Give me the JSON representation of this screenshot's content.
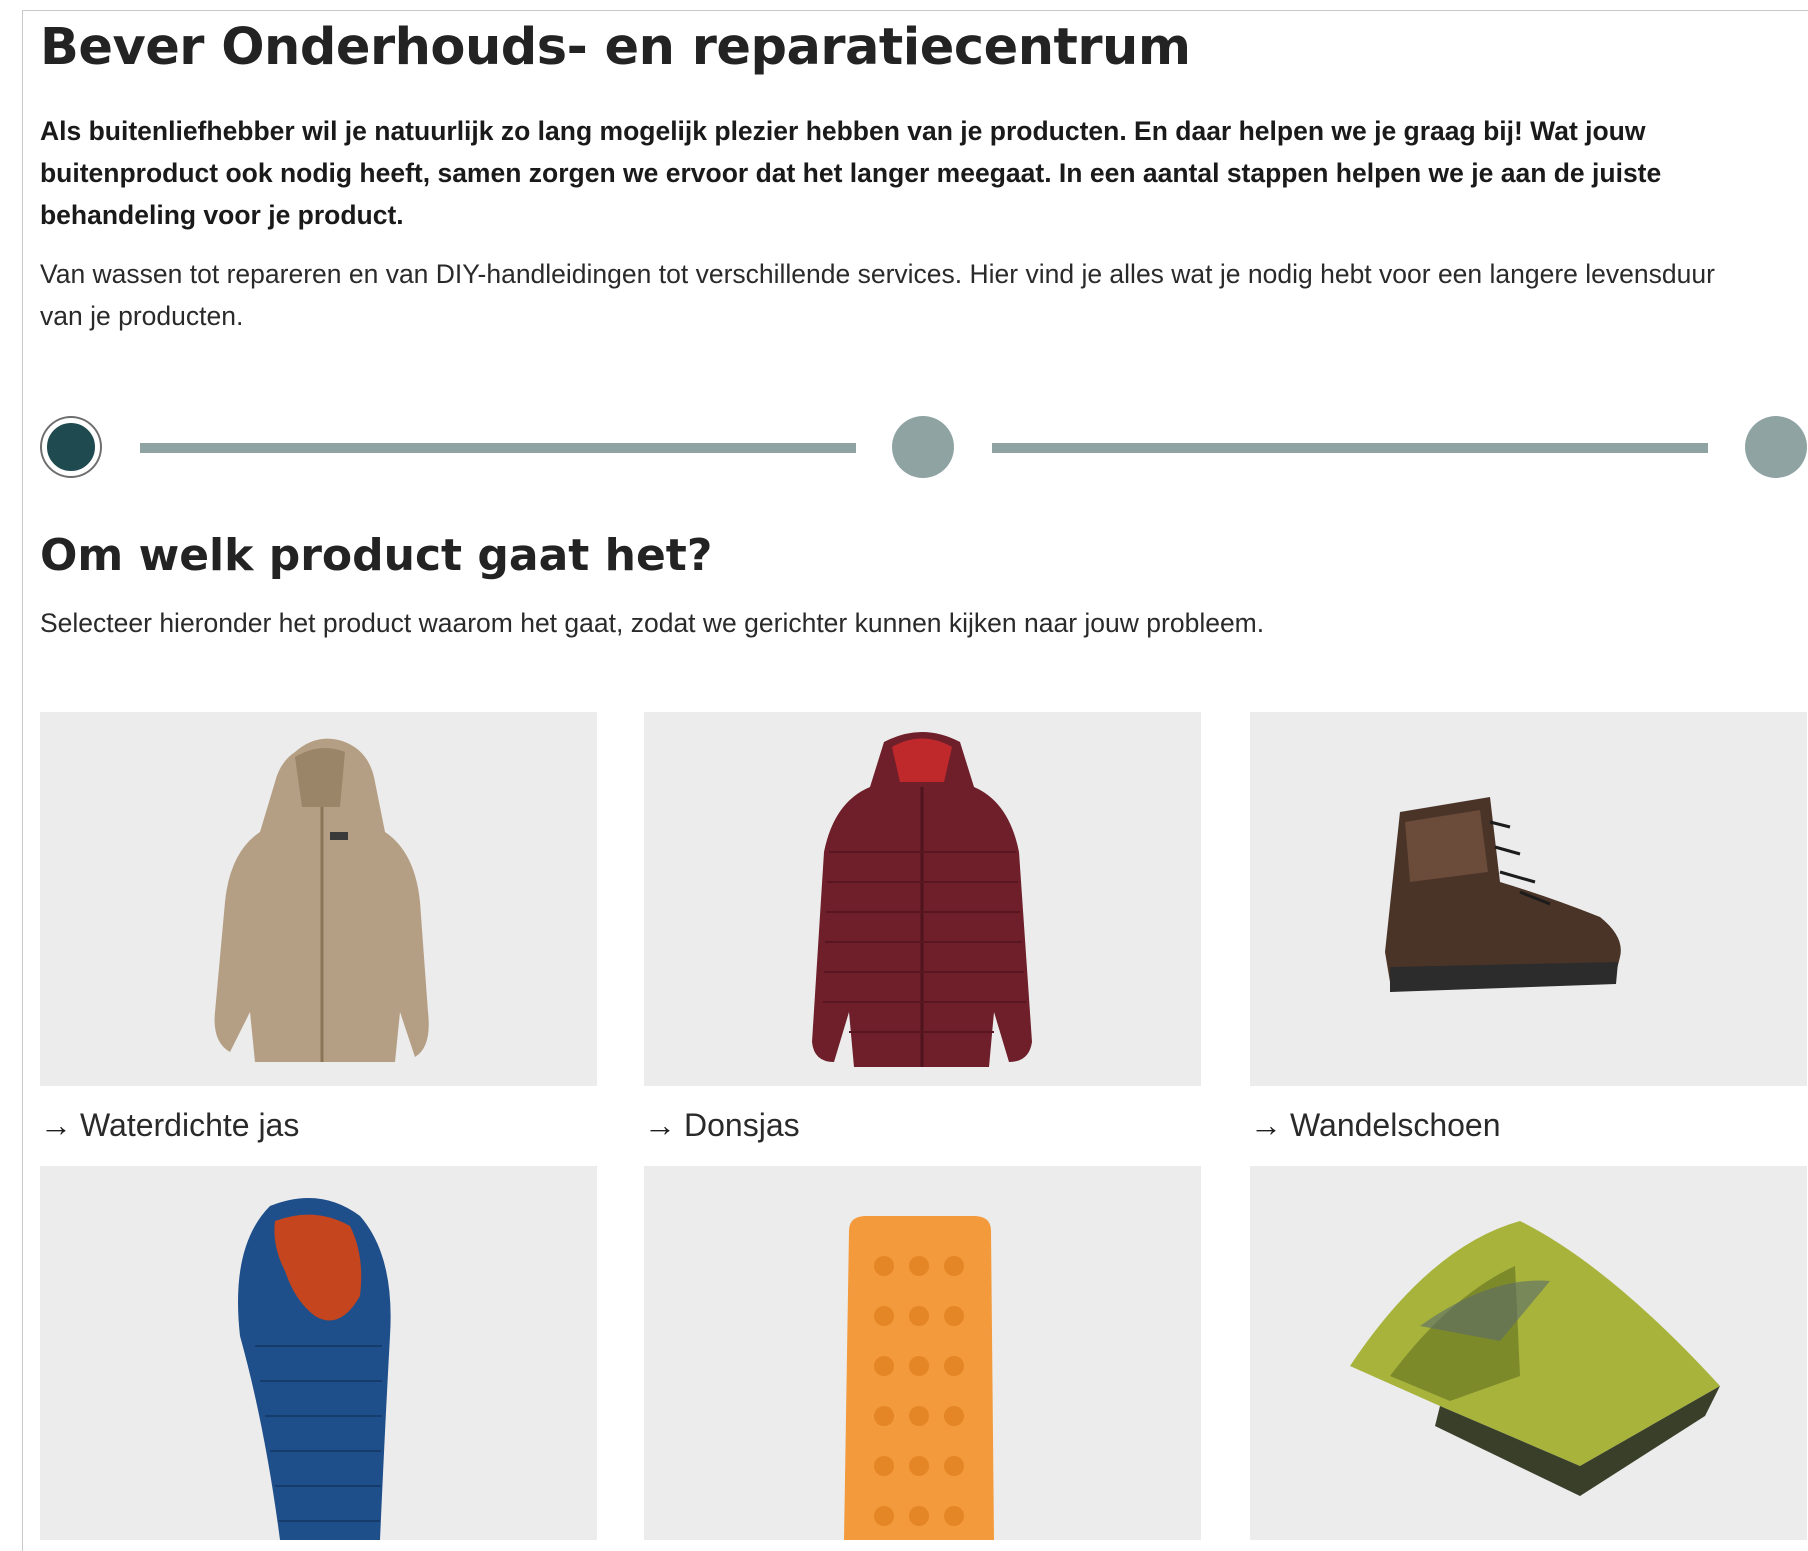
{
  "page": {
    "title": "Bever Onderhouds- en reparatiecentrum",
    "intro": "Als buitenliefhebber wil je natuurlijk zo lang mogelijk plezier hebben van je producten. En daar helpen we je graag bij! Wat jouw buitenproduct ook nodig heeft, samen zorgen we ervoor dat het langer meegaat. In een aantal stappen helpen we je aan de juiste behandeling voor je product.",
    "description": "Van wassen tot repareren en van DIY-handleidingen tot verschillende services. Hier vind je alles wat je nodig hebt voor een langere levensduur van je producten."
  },
  "stepper": {
    "current_step": 1,
    "total_steps": 3
  },
  "section": {
    "title": "Om welk product gaat het?",
    "description": "Selecteer hieronder het product waarom het gaat, zodat we gerichter kunnen kijken naar jouw probleem."
  },
  "products": [
    {
      "label": "Waterdichte jas",
      "icon": "waterproof-jacket-image",
      "arrow": "→"
    },
    {
      "label": "Donsjas",
      "icon": "down-jacket-image",
      "arrow": "→"
    },
    {
      "label": "Wandelschoen",
      "icon": "hiking-boot-image",
      "arrow": "→"
    },
    {
      "label": "",
      "icon": "sleeping-bag-image",
      "arrow": ""
    },
    {
      "label": "",
      "icon": "sleeping-mat-image",
      "arrow": ""
    },
    {
      "label": "",
      "icon": "tent-image",
      "arrow": ""
    }
  ],
  "colors": {
    "step_active": "#1f4a4f",
    "step_inactive": "#8fa3a3",
    "card_bg": "#ececec"
  }
}
